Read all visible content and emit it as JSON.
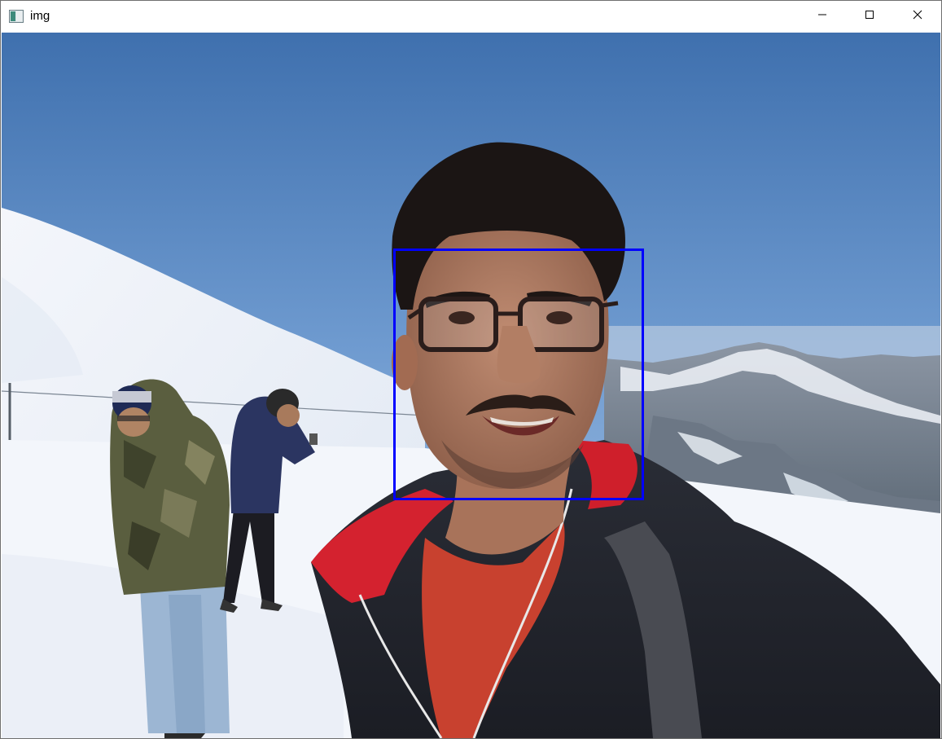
{
  "window": {
    "title": "img",
    "icon": "image-window-icon",
    "controls": {
      "minimize_icon": "minimize-icon",
      "maximize_icon": "maximize-icon",
      "close_icon": "close-icon"
    }
  },
  "image": {
    "description_icon": "photo-canvas",
    "detection": {
      "color": "#0000ff",
      "label": ""
    }
  },
  "colors": {
    "sky_top": "#3d6fae",
    "sky_bottom": "#a7c3e3",
    "snow": "#eef3fa",
    "box": "#0000ff"
  }
}
